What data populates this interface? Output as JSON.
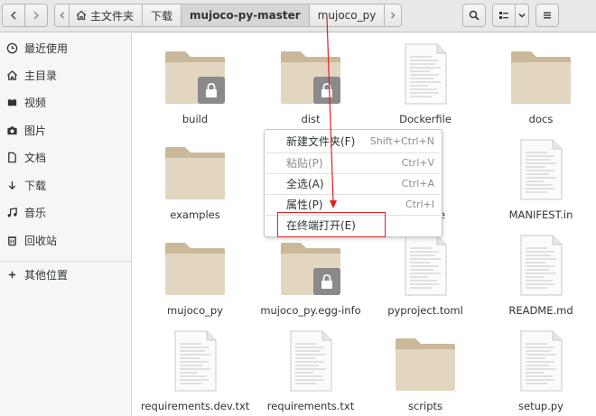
{
  "header": {
    "breadcrumbs": [
      {
        "label": "主文件夹",
        "icon": "home-icon"
      },
      {
        "label": "下载"
      },
      {
        "label": "mujoco-py-master",
        "active": true
      },
      {
        "label": "mujoco_py"
      }
    ]
  },
  "sidebar": {
    "items": [
      {
        "label": "最近使用",
        "icon": "clock-icon"
      },
      {
        "label": "主目录",
        "icon": "home-icon"
      },
      {
        "label": "视频",
        "icon": "video-icon"
      },
      {
        "label": "图片",
        "icon": "camera-icon"
      },
      {
        "label": "文档",
        "icon": "document-icon"
      },
      {
        "label": "下载",
        "icon": "download-icon"
      },
      {
        "label": "音乐",
        "icon": "music-icon"
      },
      {
        "label": "回收站",
        "icon": "trash-icon"
      },
      {
        "label": "其他位置",
        "icon": "plus-icon"
      }
    ]
  },
  "files": [
    {
      "name": "build",
      "type": "folder",
      "locked": true
    },
    {
      "name": "dist",
      "type": "folder",
      "locked": true
    },
    {
      "name": "Dockerfile",
      "type": "file"
    },
    {
      "name": "docs",
      "type": "folder"
    },
    {
      "name": "examples",
      "type": "folder"
    },
    {
      "name": "MANIFEST.in",
      "type": "file"
    },
    {
      "name": "mujoco_py",
      "type": "folder"
    },
    {
      "name": "mujoco_py.egg-info",
      "type": "folder",
      "locked": true
    },
    {
      "name": "pyproject.toml",
      "type": "file"
    },
    {
      "name": "README.md",
      "type": "file"
    },
    {
      "name": "requirements.dev.txt",
      "type": "file"
    },
    {
      "name": "requirements.txt",
      "type": "file"
    },
    {
      "name": "scripts",
      "type": "folder"
    },
    {
      "name": "setup.py",
      "type": "file"
    },
    {
      "name": "e",
      "type": "partial-label"
    }
  ],
  "context_menu": {
    "items": [
      {
        "label": "新建文件夹(F)",
        "shortcut": "Shift+Ctrl+N",
        "disabled": false
      },
      {
        "label": "粘贴(P)",
        "shortcut": "Ctrl+V",
        "disabled": true
      },
      {
        "label": "全选(A)",
        "shortcut": "Ctrl+A",
        "disabled": false
      },
      {
        "label": "属性(P)",
        "shortcut": "Ctrl+I",
        "disabled": false
      },
      {
        "label": "在终端打开(E)",
        "shortcut": "",
        "disabled": false
      }
    ]
  },
  "colors": {
    "folder_back": "#c9b99a",
    "folder_front": "#e3d6c0",
    "annotation": "#e02020"
  }
}
